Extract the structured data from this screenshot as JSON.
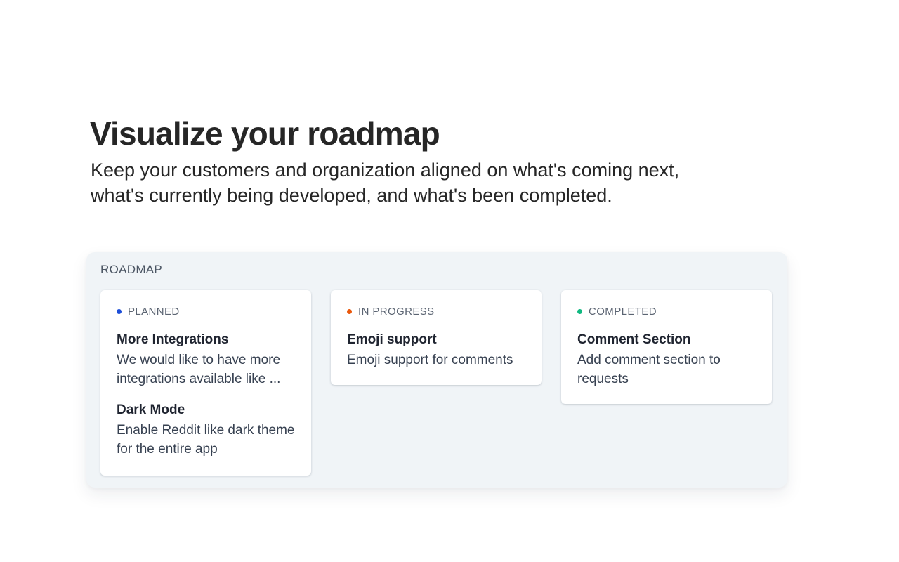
{
  "hero": {
    "title": "Visualize your roadmap",
    "subtitle": "Keep your customers and organization aligned on what's coming next, what's currently being developed, and what's been completed."
  },
  "roadmap": {
    "label": "ROADMAP",
    "columns": [
      {
        "status": "PLANNED",
        "dot_color": "#1d4ed8",
        "items": [
          {
            "title": "More Integrations",
            "description": "We would like to have more integrations available like ..."
          },
          {
            "title": "Dark Mode",
            "description": "Enable Reddit like dark theme for the entire app"
          }
        ]
      },
      {
        "status": "IN PROGRESS",
        "dot_color": "#ea580c",
        "items": [
          {
            "title": "Emoji support",
            "description": "Emoji support for comments"
          }
        ]
      },
      {
        "status": "COMPLETED",
        "dot_color": "#10b981",
        "items": [
          {
            "title": "Comment Section",
            "description": "Add comment section to requests"
          }
        ]
      }
    ]
  }
}
